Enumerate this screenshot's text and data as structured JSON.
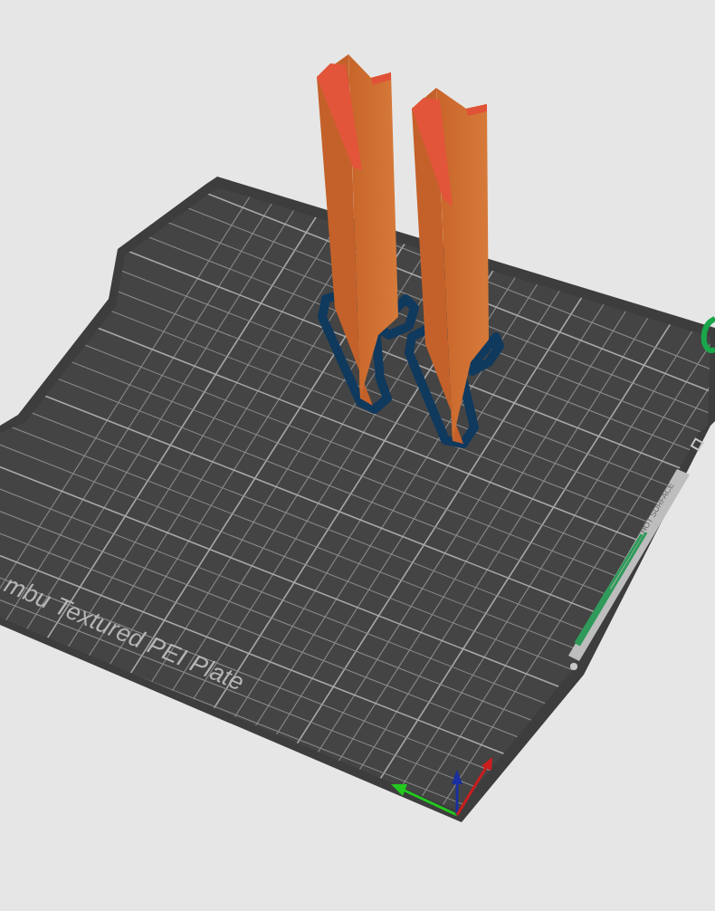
{
  "viewport": {
    "plate_label": "mbu Textured PEI Plate",
    "warning_label": "HOT SURFACE"
  }
}
